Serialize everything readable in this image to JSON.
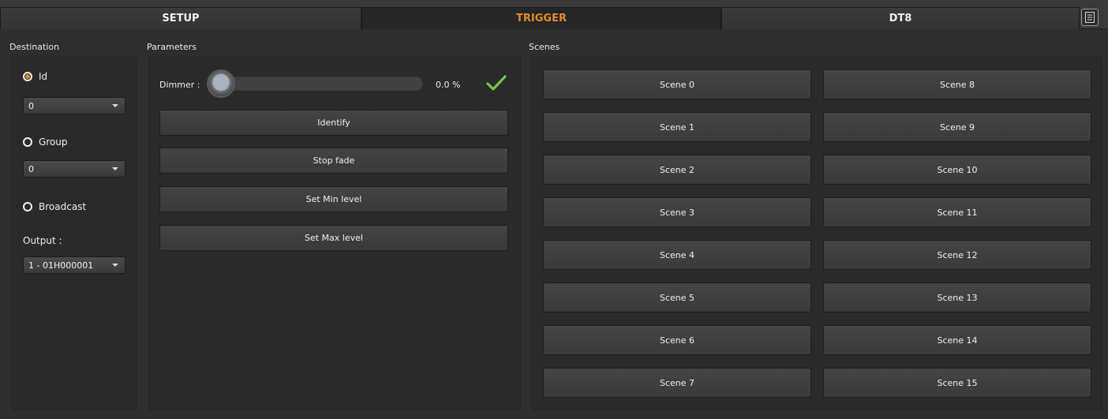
{
  "tabs": [
    {
      "label": "SETUP"
    },
    {
      "label": "TRIGGER"
    },
    {
      "label": "DT8"
    }
  ],
  "colors": {
    "accent": "#e08a2e",
    "check": "#7cc04b",
    "background": "#2e2e2e",
    "panel": "#2a2a2a"
  },
  "destination": {
    "title": "Destination",
    "id_label": "Id",
    "id_value": "0",
    "group_label": "Group",
    "group_value": "0",
    "broadcast_label": "Broadcast",
    "output_label": "Output :",
    "output_value": "1 - 01H000001",
    "selected": "Id"
  },
  "parameters": {
    "title": "Parameters",
    "dimmer_label": "Dimmer :",
    "dimmer_value": "0.0 %",
    "dimmer_level": 0,
    "buttons": [
      "Identify",
      "Stop fade",
      "Set Min level",
      "Set Max level"
    ]
  },
  "scenes": {
    "title": "Scenes",
    "items": [
      "Scene 0",
      "Scene 1",
      "Scene 2",
      "Scene 3",
      "Scene 4",
      "Scene 5",
      "Scene 6",
      "Scene 7",
      "Scene 8",
      "Scene 9",
      "Scene 10",
      "Scene 11",
      "Scene 12",
      "Scene 13",
      "Scene 14",
      "Scene 15"
    ]
  },
  "icons": {
    "menu": "document-menu-icon",
    "apply": "checkmark-icon"
  }
}
